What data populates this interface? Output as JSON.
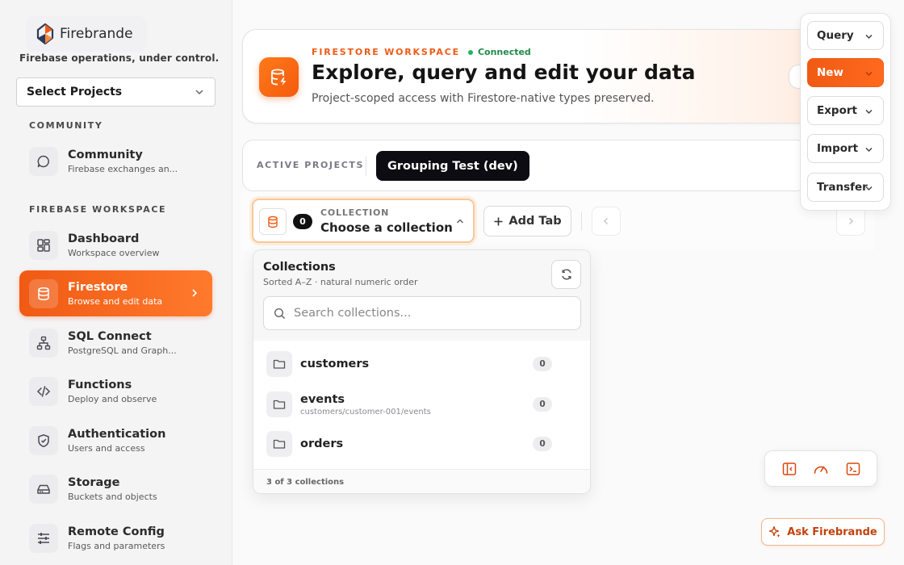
{
  "brand": {
    "name": "Firebrande",
    "tagline": "Firebase operations, under control."
  },
  "project_select": {
    "label": "Select Projects"
  },
  "sidebar": {
    "community_label": "COMMUNITY",
    "workspace_label": "FIREBASE WORKSPACE",
    "community": {
      "title": "Community",
      "desc": "Firebase exchanges an..."
    },
    "items": [
      {
        "title": "Dashboard",
        "desc": "Workspace overview",
        "icon": "dashboard-icon"
      },
      {
        "title": "Firestore",
        "desc": "Browse and edit data",
        "icon": "database-icon",
        "active": true
      },
      {
        "title": "SQL Connect",
        "desc": "PostgreSQL and Graph...",
        "icon": "sitemap-icon"
      },
      {
        "title": "Functions",
        "desc": "Deploy and observe",
        "icon": "code-icon"
      },
      {
        "title": "Authentication",
        "desc": "Users and access",
        "icon": "shield-icon"
      },
      {
        "title": "Storage",
        "desc": "Buckets and objects",
        "icon": "storage-icon"
      },
      {
        "title": "Remote Config",
        "desc": "Flags and parameters",
        "icon": "sliders-icon"
      }
    ]
  },
  "hero": {
    "kicker": "FIRESTORE WORKSPACE",
    "status": "Connected",
    "title": "Explore, query and edit your data",
    "subtitle": "Project-scoped access with Firestore-native types preserved."
  },
  "tabs_bar": {
    "label": "ACTIVE PROJECTS",
    "active_tab": "Grouping Test (dev)"
  },
  "collection_selector": {
    "badge": "0",
    "label": "COLLECTION",
    "value": "Choose a collection"
  },
  "toolbar": {
    "add_tab": "Add Tab"
  },
  "collections_panel": {
    "title": "Collections",
    "subtitle": "Sorted A–Z · natural numeric order",
    "search_placeholder": "Search collections...",
    "items": [
      {
        "name": "customers",
        "path": "",
        "count": "0"
      },
      {
        "name": "events",
        "path": "customers/customer-001/events",
        "count": "0"
      },
      {
        "name": "orders",
        "path": "",
        "count": "0"
      }
    ],
    "footer": "3 of 3 collections"
  },
  "actions_menu": {
    "query": "Query",
    "new": "New",
    "export": "Export",
    "import": "Import",
    "transfer": "Transfer"
  },
  "ask": {
    "label": "Ask Firebrande"
  },
  "colors": {
    "accent": "#f05a14",
    "status": "#22b35e"
  }
}
